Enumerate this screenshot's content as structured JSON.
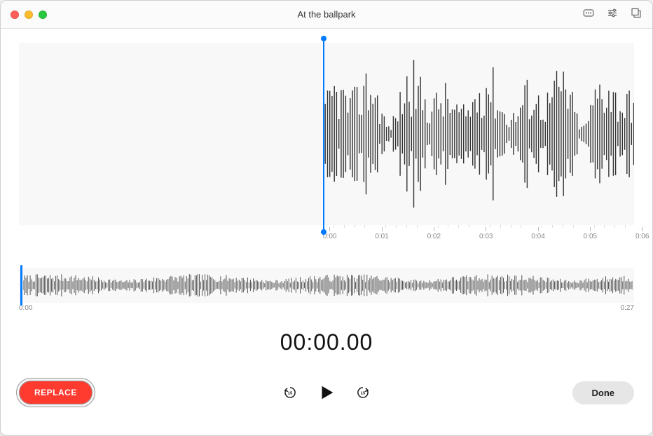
{
  "window": {
    "title": "At the ballpark"
  },
  "toolbar": {
    "icons": {
      "transcribe": "transcribe-icon",
      "settings": "playback-settings-icon",
      "trim": "trim-icon"
    }
  },
  "waveform": {
    "detail_ticks": [
      "0:00",
      "0:01",
      "0:02",
      "0:03",
      "0:04",
      "0:05",
      "0:06"
    ],
    "overview_start": "0:00",
    "overview_end": "0:27",
    "playhead_time": "0:00"
  },
  "timer": {
    "value": "00:00.00"
  },
  "controls": {
    "replace_label": "REPLACE",
    "done_label": "Done",
    "skip_back_seconds": "15",
    "skip_forward_seconds": "15"
  },
  "colors": {
    "accent": "#007aff",
    "record": "#ff3b30"
  }
}
